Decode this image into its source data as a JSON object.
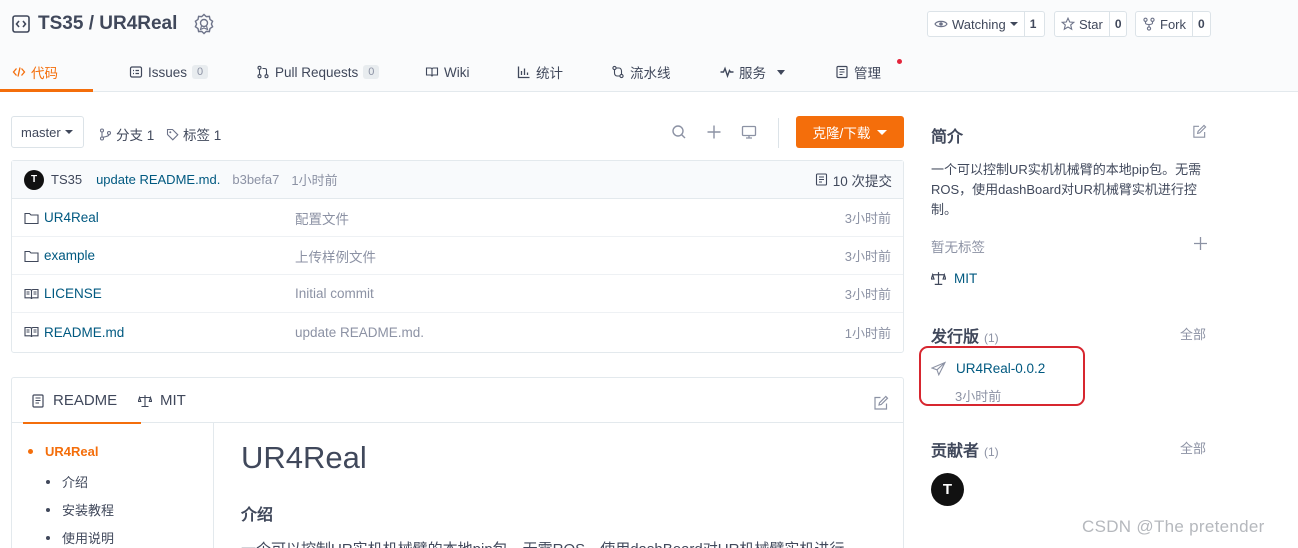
{
  "repo": {
    "title": "TS35 / UR4Real"
  },
  "actions": {
    "watch_label": "Watching",
    "watch_count": "1",
    "star_label": "Star",
    "star_count": "0",
    "fork_label": "Fork",
    "fork_count": "0"
  },
  "nav": {
    "code": "代码",
    "issues": "Issues",
    "issues_count": "0",
    "pulls": "Pull Requests",
    "pulls_count": "0",
    "wiki": "Wiki",
    "stats": "统计",
    "pipeline": "流水线",
    "services": "服务",
    "manage": "管理"
  },
  "toolbar": {
    "branch": "master",
    "branches": "分支 1",
    "tags": "标签 1",
    "clone": "克隆/下载"
  },
  "commit": {
    "avatar": "T",
    "author": "TS35",
    "message": "update README.md.",
    "sha": "b3befa7",
    "time": "1小时前",
    "count": "10 次提交"
  },
  "files": [
    {
      "type": "folder",
      "name": "UR4Real",
      "message": "配置文件",
      "time": "3小时前"
    },
    {
      "type": "folder",
      "name": "example",
      "message": "上传样例文件",
      "time": "3小时前"
    },
    {
      "type": "file",
      "name": "LICENSE",
      "message": "Initial commit",
      "time": "3小时前"
    },
    {
      "type": "file",
      "name": "README.md",
      "message": "update README.md.",
      "time": "1小时前"
    }
  ],
  "readme": {
    "tab_readme": "README",
    "tab_license": "MIT",
    "toc": [
      "UR4Real",
      "介绍",
      "安装教程",
      "使用说明"
    ],
    "h1": "UR4Real",
    "h2": "介绍",
    "paragraph": "一个可以控制UR实机机械臂的本地pip包。无需ROS，使用dashBoard对UR机械臂实机进行"
  },
  "sidebar": {
    "intro_title": "简介",
    "intro_text": "一个可以控制UR实机机械臂的本地pip包。无需ROS，使用dashBoard对UR机械臂实机进行控制。",
    "no_tags": "暂无标签",
    "license": "MIT",
    "release_title": "发行版",
    "release_count": "(1)",
    "release_all": "全部",
    "release_name": "UR4Real-0.0.2",
    "release_time": "3小时前",
    "contrib_title": "贡献者",
    "contrib_count": "(1)",
    "contrib_all": "全部",
    "contrib_avatar": "T"
  },
  "watermark": "CSDN @The  pretender",
  "colors": {
    "accent": "#f46e0b",
    "link": "#005980",
    "highlight": "#d7262f"
  }
}
